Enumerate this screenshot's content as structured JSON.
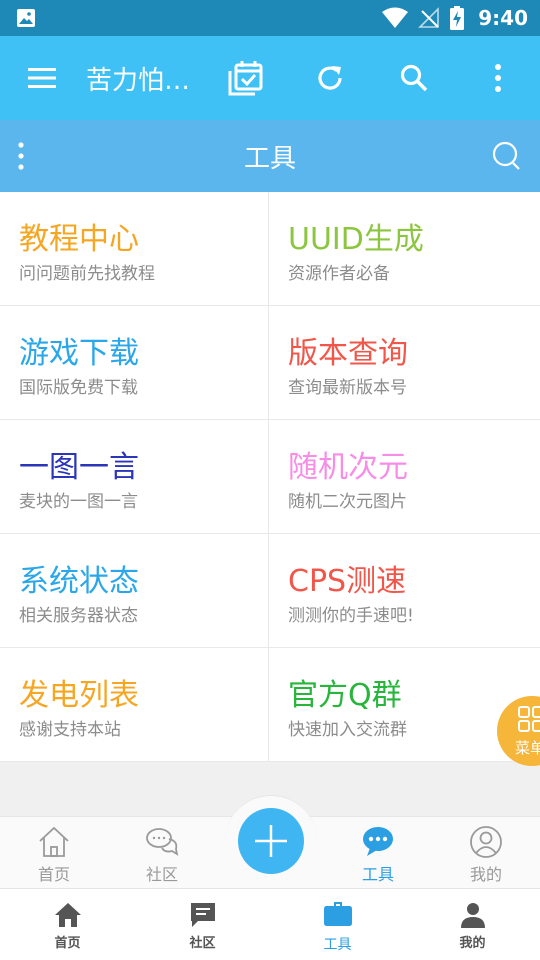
{
  "status_bar": {
    "time": "9:40"
  },
  "app_bar": {
    "title": "苦力怕…"
  },
  "tools_header": {
    "title": "工具"
  },
  "tools": [
    {
      "title": "教程中心",
      "subtitle": "问问题前先找教程",
      "color": "#f5a623"
    },
    {
      "title": "UUID生成",
      "subtitle": "资源作者必备",
      "color": "#8cc63f"
    },
    {
      "title": "游戏下载",
      "subtitle": "国际版免费下载",
      "color": "#2aa7e8"
    },
    {
      "title": "版本查询",
      "subtitle": "查询最新版本号",
      "color": "#f0574a"
    },
    {
      "title": "一图一言",
      "subtitle": "麦块的一图一言",
      "color": "#2a35b8"
    },
    {
      "title": "随机次元",
      "subtitle": "随机二次元图片",
      "color": "#f78de6"
    },
    {
      "title": "系统状态",
      "subtitle": "相关服务器状态",
      "color": "#2aa7e8"
    },
    {
      "title": "CPS测速",
      "subtitle": "测测你的手速吧!",
      "color": "#f0574a"
    },
    {
      "title": "发电列表",
      "subtitle": "感谢支持本站",
      "color": "#f5a623"
    },
    {
      "title": "官方Q群",
      "subtitle": "快速加入交流群",
      "color": "#27b53b"
    }
  ],
  "float_menu": {
    "label": "菜单"
  },
  "inner_tabs": [
    {
      "label": "首页",
      "icon": "home-outline-icon"
    },
    {
      "label": "社区",
      "icon": "chat-bubbles-icon"
    },
    {
      "label": "工具",
      "icon": "chat-dots-icon",
      "active": true
    },
    {
      "label": "我的",
      "icon": "user-circle-icon"
    }
  ],
  "bottom_nav": [
    {
      "label": "首页",
      "icon": "home-icon"
    },
    {
      "label": "社区",
      "icon": "message-icon"
    },
    {
      "label": "工具",
      "icon": "briefcase-icon",
      "active": true
    },
    {
      "label": "我的",
      "icon": "person-icon"
    }
  ],
  "colors": {
    "status_bar": "#1e88b7",
    "app_bar": "#3fc1f5",
    "tools_header": "#5bb6ee",
    "accent": "#2c9fe3",
    "float_menu": "#f5b63a"
  }
}
